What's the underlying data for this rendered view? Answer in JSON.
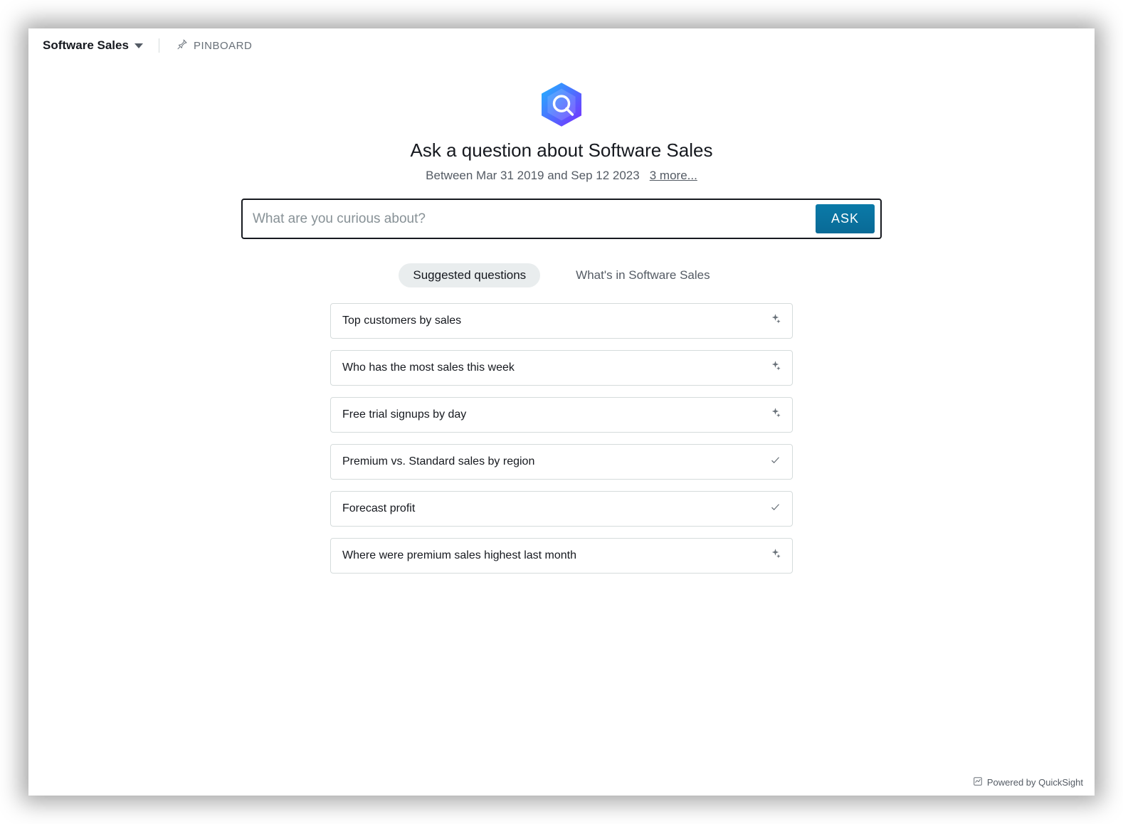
{
  "header": {
    "topic_name": "Software Sales",
    "pinboard_label": "PINBOARD"
  },
  "hero": {
    "title": "Ask a question about Software Sales",
    "date_range": "Between Mar 31 2019 and Sep 12 2023",
    "more_link": "3 more..."
  },
  "ask": {
    "placeholder": "What are you curious about?",
    "button_label": "ASK"
  },
  "tabs": {
    "suggested": "Suggested questions",
    "whats_in": "What's in Software Sales"
  },
  "suggestions": [
    {
      "text": "Top customers by sales",
      "icon": "sparkle"
    },
    {
      "text": "Who has the most sales this week",
      "icon": "sparkle"
    },
    {
      "text": "Free trial signups by day",
      "icon": "sparkle"
    },
    {
      "text": "Premium vs. Standard sales by region",
      "icon": "check"
    },
    {
      "text": "Forecast profit",
      "icon": "check"
    },
    {
      "text": "Where were premium sales highest last month",
      "icon": "sparkle"
    }
  ],
  "footer": {
    "text": "Powered by QuickSight"
  }
}
